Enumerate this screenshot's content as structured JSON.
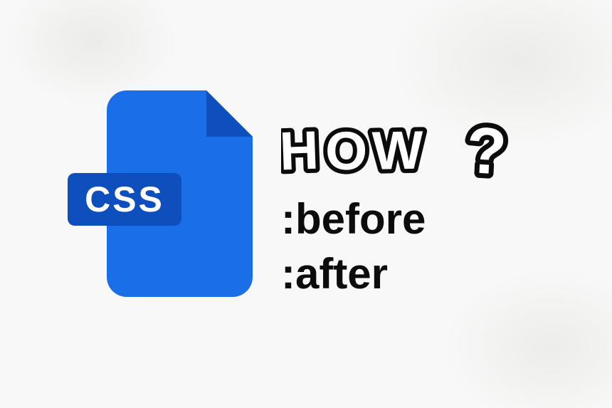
{
  "icon": {
    "label": "CSS"
  },
  "heading": {
    "text": "HOW",
    "qmark": "?"
  },
  "lines": {
    "before": ":before",
    "after": ":after"
  }
}
